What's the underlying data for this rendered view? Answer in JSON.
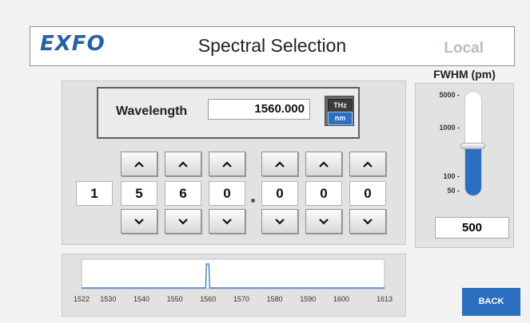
{
  "header": {
    "logo": "EXFO",
    "title": "Spectral Selection",
    "mode": "Local"
  },
  "wavelength": {
    "label": "Wavelength",
    "value": "1560.000",
    "units": [
      "THz",
      "nm"
    ],
    "selected_unit": "nm"
  },
  "digits": [
    "1",
    "5",
    "6",
    "0",
    "0",
    "0",
    "0"
  ],
  "fwhm": {
    "title": "FWHM (pm)",
    "ticks": [
      "5000 -",
      "1000 -",
      "100 -",
      "50 -"
    ],
    "value": "500",
    "level_fraction": 0.48
  },
  "spectrum": {
    "x_ticks": [
      "1522",
      "1530",
      "1540",
      "1550",
      "1560",
      "1570",
      "1580",
      "1590",
      "1600",
      "1613"
    ],
    "peak_nm": 1560,
    "line_color": "#2a6fc0"
  },
  "back_label": "BACK"
}
